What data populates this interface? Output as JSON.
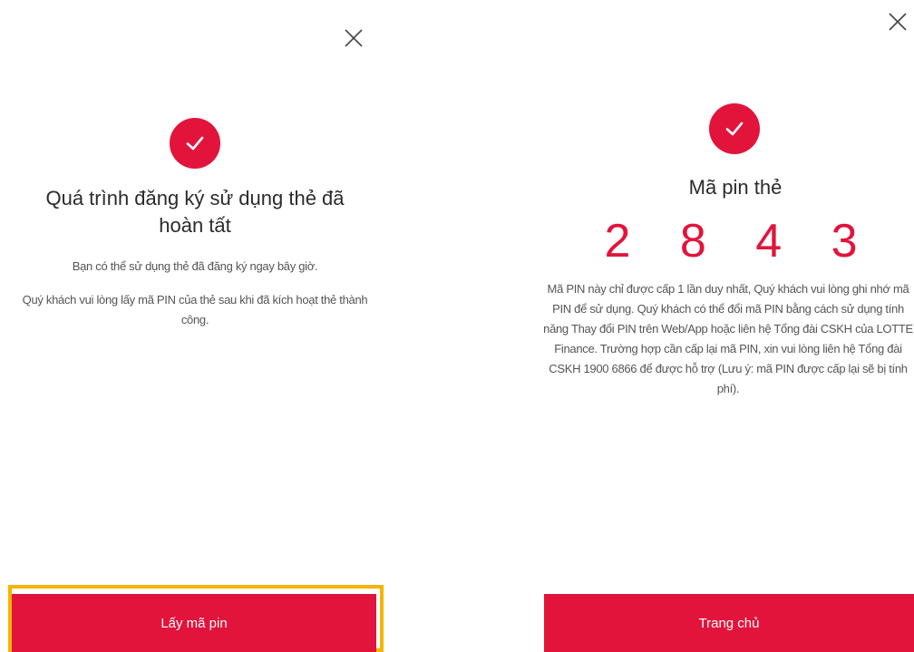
{
  "left": {
    "close_icon": "close-icon",
    "success_icon": "check-circle-icon",
    "title": "Quá trình đăng ký sử dụng thẻ đã hoàn tất",
    "message_1": "Bạn có thể sử dụng thẻ đã đăng ký ngay bây giờ.",
    "message_2": "Quý khách vui lòng lấy mã PIN của thẻ sau khi đã kích hoạt thẻ thành công.",
    "button_label": "Lấy mã pin"
  },
  "right": {
    "close_icon": "close-icon",
    "success_icon": "check-circle-icon",
    "title": "Mã pin thẻ",
    "pin": "2 8 4 3",
    "note": "Mã PIN này chỉ được cấp 1 lần duy nhất, Quý khách vui lòng ghi nhớ mã PIN để sử dụng. Quý khách có thể đổi mã PIN bằng cách sử dụng tính năng Thay đổi PIN trên Web/App hoặc liên hệ Tổng đài CSKH của LOTTE Finance. Trường hợp cần cấp lại mã PIN, xin vui lòng liên hệ Tổng đài CSKH 1900 6866 để được hỗ trợ (Lưu ý: mã PIN được cấp lại sẽ bị tính phí).",
    "button_label": "Trang chủ"
  },
  "colors": {
    "accent": "#e2143c",
    "highlight": "#f5b400"
  }
}
